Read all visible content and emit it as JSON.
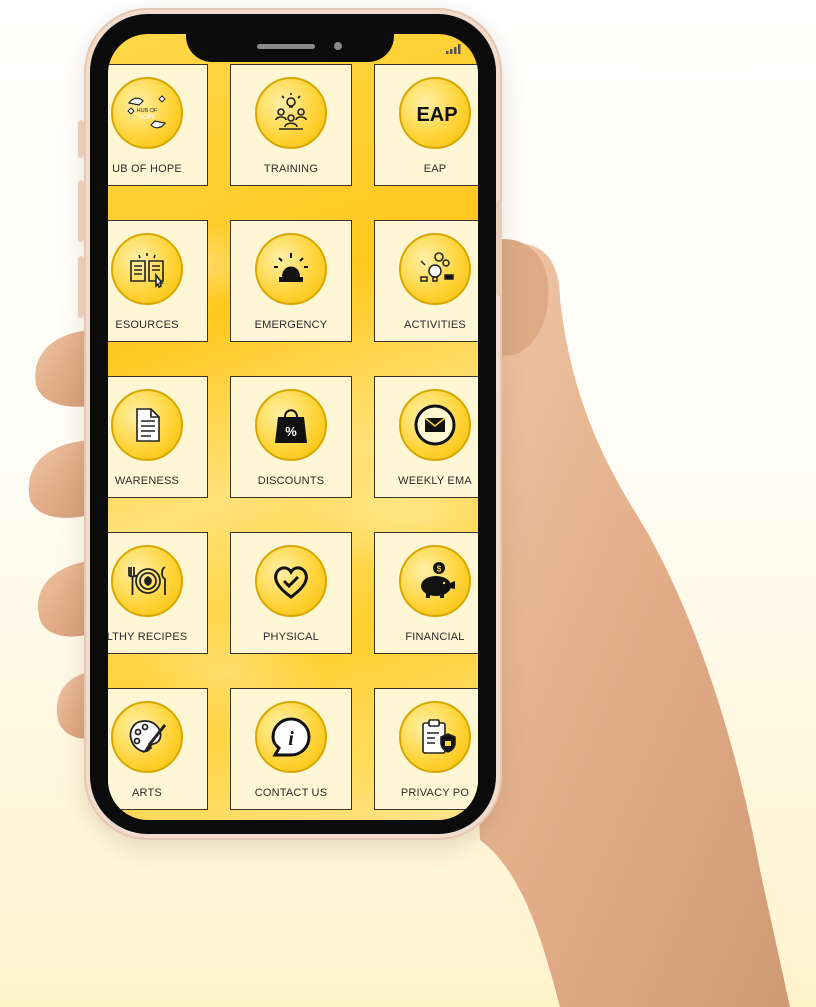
{
  "app": {
    "tiles": [
      {
        "label": "UB OF HOPE",
        "icon": "hub-of-hope-icon",
        "icon_text": [
          "HUB OF",
          "HOPE"
        ]
      },
      {
        "label": "TRAINING",
        "icon": "training-icon"
      },
      {
        "label": "EAP",
        "icon": "eap-icon",
        "icon_text": [
          "EAP"
        ]
      },
      {
        "label": "ESOURCES",
        "icon": "resources-icon"
      },
      {
        "label": "EMERGENCY",
        "icon": "emergency-siren-icon"
      },
      {
        "label": "ACTIVITIES",
        "icon": "activities-icon"
      },
      {
        "label": "WARENESS",
        "icon": "document-icon"
      },
      {
        "label": "DISCOUNTS",
        "icon": "shopping-bag-percent-icon",
        "icon_text": [
          "%"
        ]
      },
      {
        "label": "WEEKLY EMA",
        "icon": "envelope-icon"
      },
      {
        "label": "LTHY RECIPES",
        "icon": "recipes-plate-icon"
      },
      {
        "label": "PHYSICAL",
        "icon": "heart-check-icon"
      },
      {
        "label": "FINANCIAL",
        "icon": "piggy-bank-icon",
        "icon_text": [
          "$"
        ]
      },
      {
        "label": "ARTS",
        "icon": "palette-icon"
      },
      {
        "label": "CONTACT US",
        "icon": "info-bubble-icon",
        "icon_text": [
          "i"
        ]
      },
      {
        "label": "PRIVACY PO",
        "icon": "privacy-clipboard-icon"
      }
    ]
  },
  "colors": {
    "accent": "#ffc81f",
    "tile_background": "#fff6d6",
    "phone_frame": "#f2dccd",
    "skin": "#e4b493"
  }
}
